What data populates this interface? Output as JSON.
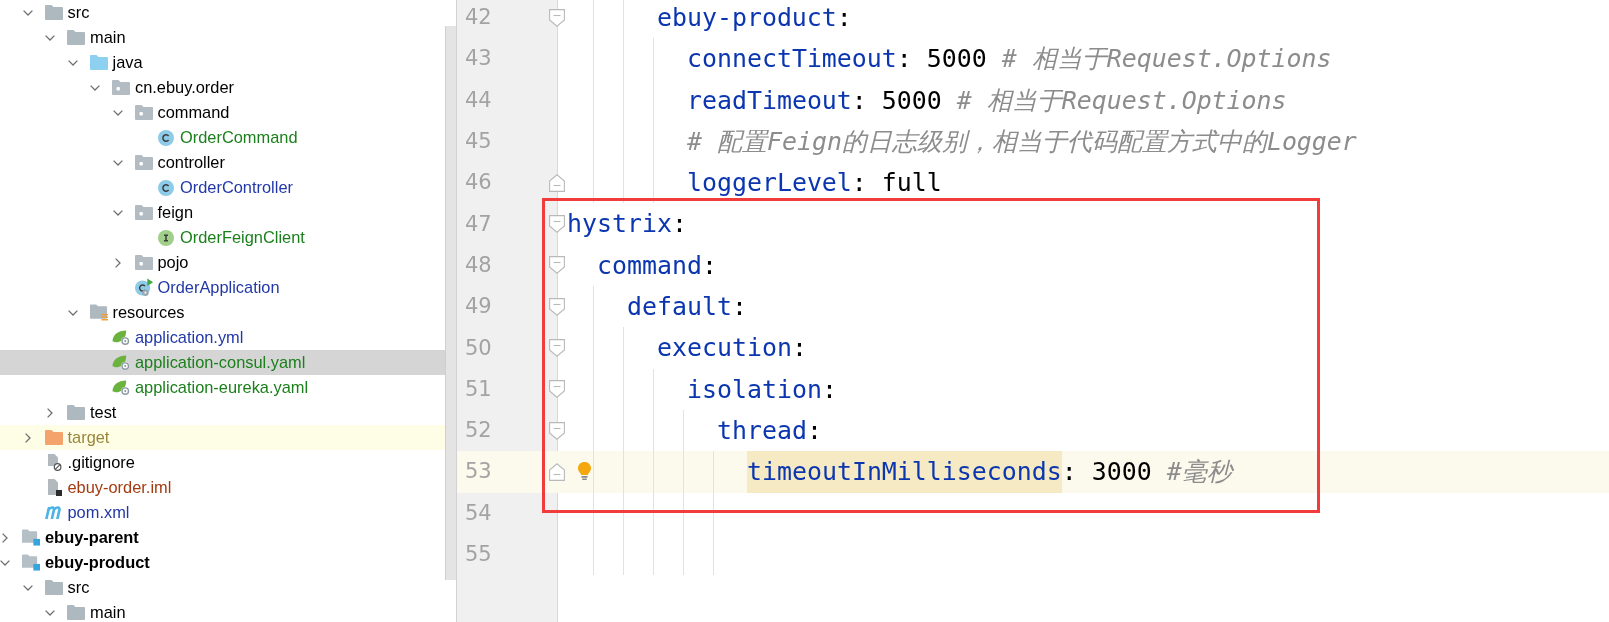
{
  "project_tree": {
    "continued_items": [
      {
        "label": "src",
        "kind": "folder",
        "expanded": true,
        "selected": false,
        "children": [
          {
            "label": "main",
            "kind": "folder",
            "expanded": true,
            "selected": false,
            "children": [
              {
                "label": "java",
                "kind": "source_folder",
                "expanded": true,
                "selected": false,
                "children": [
                  {
                    "label": "cn.ebuy.order",
                    "kind": "package",
                    "expanded": true,
                    "selected": false,
                    "children": [
                      {
                        "label": "command",
                        "kind": "package",
                        "expanded": true,
                        "selected": false,
                        "children": [
                          {
                            "label": "OrderCommand",
                            "kind": "class",
                            "color": "#1b7f1b",
                            "selected": false
                          }
                        ]
                      },
                      {
                        "label": "controller",
                        "kind": "package",
                        "expanded": true,
                        "selected": false,
                        "children": [
                          {
                            "label": "OrderController",
                            "kind": "class",
                            "color": "#2238a8",
                            "selected": false
                          }
                        ]
                      },
                      {
                        "label": "feign",
                        "kind": "package",
                        "expanded": true,
                        "selected": false,
                        "children": [
                          {
                            "label": "OrderFeignClient",
                            "kind": "interface",
                            "color": "#1b7f1b",
                            "selected": false
                          }
                        ]
                      },
                      {
                        "label": "pojo",
                        "kind": "package",
                        "expanded": false,
                        "selected": false
                      },
                      {
                        "label": "OrderApplication",
                        "kind": "application_class",
                        "color": "#2238a8",
                        "selected": false
                      }
                    ]
                  }
                ]
              },
              {
                "label": "resources",
                "kind": "resources_folder",
                "expanded": true,
                "selected": false,
                "children": [
                  {
                    "label": "application.yml",
                    "kind": "yaml",
                    "color": "#2238a8",
                    "selected": false
                  },
                  {
                    "label": "application-consul.yaml",
                    "kind": "yaml",
                    "color": "#1b7f1b",
                    "selected": true
                  },
                  {
                    "label": "application-eureka.yaml",
                    "kind": "yaml",
                    "color": "#1b7f1b",
                    "selected": false
                  }
                ]
              }
            ]
          },
          {
            "label": "test",
            "kind": "folder",
            "expanded": false,
            "selected": false
          }
        ]
      },
      {
        "label": "target",
        "kind": "excluded_folder",
        "color": "#98873a",
        "ignored": true,
        "expanded": false,
        "selected": false
      },
      {
        "label": ".gitignore",
        "kind": "ignore_file",
        "selected": false
      },
      {
        "label": "ebuy-order.iml",
        "kind": "iml_file",
        "color": "#a33a10",
        "selected": false
      },
      {
        "label": "pom.xml",
        "kind": "pom_file",
        "color": "#2238a8",
        "selected": false
      }
    ],
    "modules": [
      {
        "label": "ebuy-parent",
        "kind": "module",
        "expanded": false,
        "selected": false
      },
      {
        "label": "ebuy-product",
        "kind": "module",
        "expanded": true,
        "selected": false,
        "children": [
          {
            "label": "src",
            "kind": "folder",
            "expanded": true,
            "selected": false,
            "children": [
              {
                "label": "main",
                "kind": "folder",
                "expanded": true,
                "selected": false
              }
            ]
          }
        ]
      }
    ]
  },
  "editor": {
    "continued_lines": [
      {
        "number": "42",
        "fold_start": true,
        "tokens": [
          {
            "kind": "key",
            "text": "ebuy-product"
          },
          {
            "kind": "colon",
            "text": ":"
          }
        ],
        "children": [
          {
            "number": "43",
            "tokens": [
              {
                "kind": "key",
                "text": "connectTimeout"
              },
              {
                "kind": "colon",
                "text": ":"
              },
              {
                "kind": "number",
                "text": "5000"
              },
              {
                "kind": "comment",
                "text": "# 相当于Request.Options"
              }
            ]
          },
          {
            "number": "44",
            "tokens": [
              {
                "kind": "key",
                "text": "readTimeout"
              },
              {
                "kind": "colon",
                "text": ":"
              },
              {
                "kind": "number",
                "text": "5000"
              },
              {
                "kind": "comment",
                "text": "# 相当于Request.Options"
              }
            ]
          },
          {
            "number": "45",
            "tokens": [
              {
                "kind": "comment",
                "text": "# 配置Feign的日志级别，相当于代码配置方式中的Logger"
              }
            ]
          },
          {
            "number": "46",
            "fold_end": true,
            "tokens": [
              {
                "kind": "key",
                "text": "loggerLevel"
              },
              {
                "kind": "colon",
                "text": ":"
              },
              {
                "kind": "scalar",
                "text": "full"
              }
            ]
          }
        ]
      }
    ],
    "lines": [
      {
        "number": "47",
        "fold_start": true,
        "tokens": [
          {
            "kind": "key",
            "text": "hystrix"
          },
          {
            "kind": "colon",
            "text": ":"
          }
        ],
        "children": [
          {
            "number": "48",
            "fold_start": true,
            "tokens": [
              {
                "kind": "key",
                "text": "command"
              },
              {
                "kind": "colon",
                "text": ":"
              }
            ],
            "children": [
              {
                "number": "49",
                "fold_start": true,
                "tokens": [
                  {
                    "kind": "key",
                    "text": "default"
                  },
                  {
                    "kind": "colon",
                    "text": ":"
                  }
                ],
                "children": [
                  {
                    "number": "50",
                    "fold_start": true,
                    "tokens": [
                      {
                        "kind": "key",
                        "text": "execution"
                      },
                      {
                        "kind": "colon",
                        "text": ":"
                      }
                    ],
                    "children": [
                      {
                        "number": "51",
                        "fold_start": true,
                        "tokens": [
                          {
                            "kind": "key",
                            "text": "isolation"
                          },
                          {
                            "kind": "colon",
                            "text": ":"
                          }
                        ],
                        "children": [
                          {
                            "number": "52",
                            "fold_start": true,
                            "tokens": [
                              {
                                "kind": "key",
                                "text": "thread"
                              },
                              {
                                "kind": "colon",
                                "text": ":"
                              }
                            ],
                            "children": [
                              {
                                "number": "53",
                                "fold_end": true,
                                "current": true,
                                "intention_bulb": true,
                                "tokens": [
                                  {
                                    "kind": "key",
                                    "text": "timeoutInMilliseconds",
                                    "highlighted": true
                                  },
                                  {
                                    "kind": "colon",
                                    "text": ":"
                                  },
                                  {
                                    "kind": "number",
                                    "text": "3000"
                                  },
                                  {
                                    "kind": "comment",
                                    "text": "#毫秒"
                                  }
                                ]
                              }
                            ]
                          }
                        ]
                      }
                    ]
                  }
                ]
              }
            ]
          }
        ]
      },
      {
        "number": "54"
      },
      {
        "number": "55"
      }
    ]
  },
  "annotation": {
    "kind": "rectangle"
  }
}
